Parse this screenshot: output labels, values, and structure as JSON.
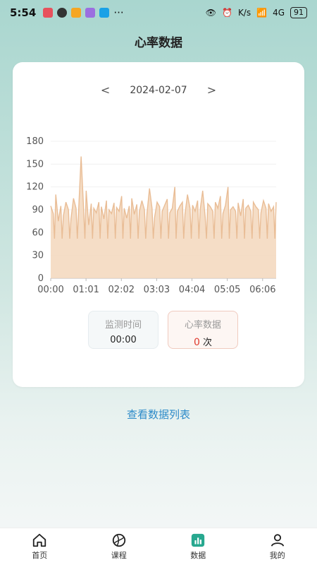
{
  "status": {
    "time": "5:54",
    "battery": "91",
    "net": "K/s",
    "net_type": "4G"
  },
  "header": {
    "title": "心率数据"
  },
  "date_nav": {
    "prev": "<",
    "date": "2024-02-07",
    "next": ">"
  },
  "chart_data": {
    "type": "area",
    "x": [
      "00:00",
      "01:01",
      "02:02",
      "03:03",
      "04:04",
      "05:05",
      "06:06"
    ],
    "yticks": [
      0,
      30,
      60,
      90,
      120,
      150,
      180
    ],
    "ylim": [
      0,
      180
    ],
    "series": [
      {
        "values": [
          95,
          85,
          110,
          75,
          95,
          82,
          100,
          90,
          78,
          105,
          92,
          88,
          160,
          90,
          115,
          70,
          98,
          92,
          86,
          100,
          94,
          78,
          102,
          90,
          85,
          99,
          93,
          88,
          108,
          92,
          79,
          95,
          105,
          84,
          97,
          88,
          102,
          90,
          85,
          118,
          92,
          80,
          100,
          94,
          88,
          96,
          104,
          86,
          92,
          120,
          88,
          95,
          100,
          84,
          110,
          92,
          96,
          88,
          102,
          90,
          115,
          80,
          98,
          94,
          88,
          100,
          92,
          108,
          85,
          96,
          120,
          90,
          94,
          88,
          99,
          82,
          104,
          92,
          96,
          88,
          100,
          94,
          90,
          86,
          102,
          92,
          98,
          88,
          94,
          100
        ]
      }
    ],
    "grid": true
  },
  "stats": {
    "time_label": "监测时间",
    "time_value": "00:00",
    "rate_label": "心率数据",
    "rate_value": "0",
    "rate_unit": "次"
  },
  "link": {
    "label": "查看数据列表"
  },
  "tabs": [
    {
      "label": "首页",
      "icon": "home-icon"
    },
    {
      "label": "课程",
      "icon": "ball-icon"
    },
    {
      "label": "数据",
      "icon": "chart-icon"
    },
    {
      "label": "我的",
      "icon": "user-icon"
    }
  ],
  "colors": {
    "line": "#e9bd96",
    "fill": "#f3d7bc",
    "accent": "#27a88f",
    "link": "#2d8bc9"
  }
}
